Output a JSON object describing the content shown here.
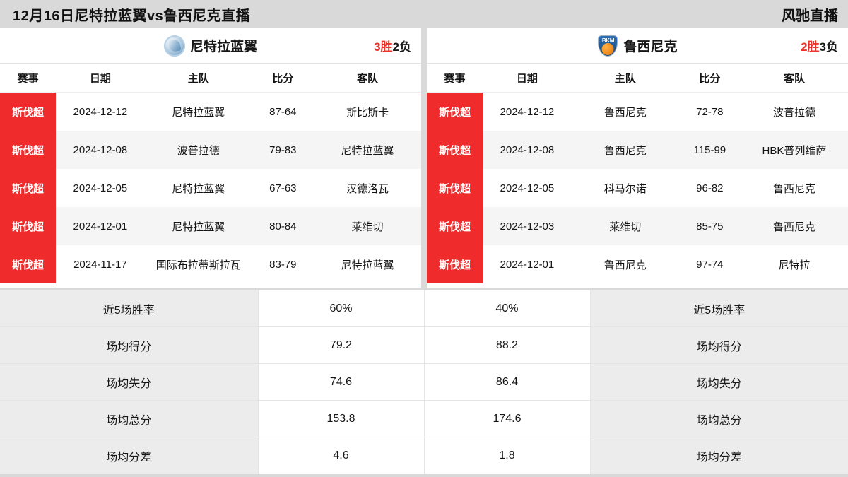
{
  "header": {
    "title": "12月16日尼特拉蓝翼vs鲁西尼克直播",
    "brand": "风驰直播"
  },
  "columns": {
    "league": "赛事",
    "date": "日期",
    "home": "主队",
    "score": "比分",
    "away": "客队"
  },
  "left_panel": {
    "team_name": "尼特拉蓝翼",
    "logo": "nitra-blue-wings-circle-logo",
    "record_wins": "3胜",
    "record_losses": "2负",
    "matches": [
      {
        "league": "斯伐超",
        "date": "2024-12-12",
        "home": "尼特拉蓝翼",
        "score": "87-64",
        "away": "斯比斯卡"
      },
      {
        "league": "斯伐超",
        "date": "2024-12-08",
        "home": "波普拉德",
        "score": "79-83",
        "away": "尼特拉蓝翼"
      },
      {
        "league": "斯伐超",
        "date": "2024-12-05",
        "home": "尼特拉蓝翼",
        "score": "67-63",
        "away": "汉德洛瓦"
      },
      {
        "league": "斯伐超",
        "date": "2024-12-01",
        "home": "尼特拉蓝翼",
        "score": "80-84",
        "away": "莱维切"
      },
      {
        "league": "斯伐超",
        "date": "2024-11-17",
        "home": "国际布拉蒂斯拉瓦",
        "score": "83-79",
        "away": "尼特拉蓝翼"
      }
    ]
  },
  "right_panel": {
    "team_name": "鲁西尼克",
    "logo": "bkm-shield-logo",
    "record_wins": "2胜",
    "record_losses": "3负",
    "matches": [
      {
        "league": "斯伐超",
        "date": "2024-12-12",
        "home": "鲁西尼克",
        "score": "72-78",
        "away": "波普拉德"
      },
      {
        "league": "斯伐超",
        "date": "2024-12-08",
        "home": "鲁西尼克",
        "score": "115-99",
        "away": "HBK普列维萨"
      },
      {
        "league": "斯伐超",
        "date": "2024-12-05",
        "home": "科马尔诺",
        "score": "96-82",
        "away": "鲁西尼克"
      },
      {
        "league": "斯伐超",
        "date": "2024-12-03",
        "home": "莱维切",
        "score": "85-75",
        "away": "鲁西尼克"
      },
      {
        "league": "斯伐超",
        "date": "2024-12-01",
        "home": "鲁西尼克",
        "score": "97-74",
        "away": "尼特拉"
      }
    ]
  },
  "stats": [
    {
      "label_left": "近5场胜率",
      "value_left": "60%",
      "value_right": "40%",
      "label_right": "近5场胜率"
    },
    {
      "label_left": "场均得分",
      "value_left": "79.2",
      "value_right": "88.2",
      "label_right": "场均得分"
    },
    {
      "label_left": "场均失分",
      "value_left": "74.6",
      "value_right": "86.4",
      "label_right": "场均失分"
    },
    {
      "label_left": "场均总分",
      "value_left": "153.8",
      "value_right": "174.6",
      "label_right": "场均总分"
    },
    {
      "label_left": "场均分差",
      "value_left": "4.6",
      "value_right": "1.8",
      "label_right": "场均分差"
    }
  ],
  "colors": {
    "league_badge": "#ef2b2b",
    "win_text": "#e8342b",
    "page_background": "#d9d9d9",
    "stat_label_background": "#ececec"
  }
}
